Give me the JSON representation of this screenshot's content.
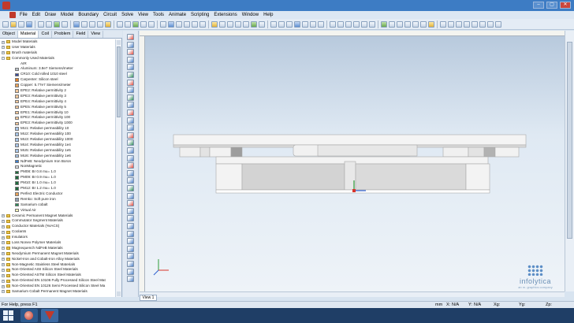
{
  "menu": [
    "File",
    "Edit",
    "Draw",
    "Model",
    "Boundary",
    "Circuit",
    "Solve",
    "View",
    "Tools",
    "Animate",
    "Scripting",
    "Extensions",
    "Window",
    "Help"
  ],
  "panel_tabs": [
    "Object",
    "Material",
    "Coil",
    "Problem",
    "Field",
    "View"
  ],
  "tree": [
    {
      "label": "Model Materials",
      "level": 0,
      "kind": "folder"
    },
    {
      "label": "User Materials",
      "level": 0,
      "kind": "folder"
    },
    {
      "label": "Brush materials",
      "level": 0,
      "kind": "folder"
    },
    {
      "label": "Commonly Used Materials",
      "level": 0,
      "kind": "folder",
      "expanded": true
    },
    {
      "label": "AIR",
      "level": 1,
      "kind": "none"
    },
    {
      "label": "Aluminum: 3.8e7 Siemens/meter",
      "level": 1,
      "color": "#b9c0c9"
    },
    {
      "label": "CR10: Cold rolled 1010 steel",
      "level": 1,
      "color": "#3b4a9a"
    },
    {
      "label": "Carpenter: Silicon steel",
      "level": 1,
      "color": "#e67e22"
    },
    {
      "label": "Copper: 5.77e7 Siemens/meter",
      "level": 1,
      "color": "#e8a25a"
    },
    {
      "label": "EPE2: Relative permittivity 2",
      "level": 1,
      "color": "#f2c89c"
    },
    {
      "label": "EPE3: Relative permittivity 3",
      "level": 1,
      "color": "#f2c89c"
    },
    {
      "label": "EPE4: Relative permittivity 4",
      "level": 1,
      "color": "#f2c89c"
    },
    {
      "label": "EPE5: Relative permittivity 5",
      "level": 1,
      "color": "#f2c89c"
    },
    {
      "label": "EPE1: Relative permittivity 10",
      "level": 1,
      "color": "#f2c89c"
    },
    {
      "label": "EPE2: Relative permittivity 100",
      "level": 1,
      "color": "#f2c89c"
    },
    {
      "label": "EPE3: Relative permittivity 1000",
      "level": 1,
      "color": "#f2c89c"
    },
    {
      "label": "MU1: Relative permeability 10",
      "level": 1,
      "color": "#a9c6e8"
    },
    {
      "label": "MU2: Relative permeability 100",
      "level": 1,
      "color": "#a9c6e8"
    },
    {
      "label": "MU3: Relative permeability 1000",
      "level": 1,
      "color": "#a9c6e8"
    },
    {
      "label": "MU4: Relative permeability 1e4",
      "level": 1,
      "color": "#a9c6e8"
    },
    {
      "label": "MU5: Relative permeability 1e5",
      "level": 1,
      "color": "#a9c6e8"
    },
    {
      "label": "MU6: Relative permeability 1e6",
      "level": 1,
      "color": "#a9c6e8"
    },
    {
      "label": "NdFeB: Neodymium Iron Boron",
      "level": 1,
      "color": "#3a7fd1"
    },
    {
      "label": "NonMagnetic",
      "level": 1,
      "color": "#d9dde2"
    },
    {
      "label": "PM08: Br 0.8 mu= 1.0",
      "level": 1,
      "color": "#1e6b3e"
    },
    {
      "label": "PM09: Br 0.9 mu= 1.0",
      "level": 1,
      "color": "#1e6b3e"
    },
    {
      "label": "PM10: Br 1.0 mu= 1.0",
      "level": 1,
      "color": "#1e6b3e"
    },
    {
      "label": "PM12: Br 1.2 mu= 1.0",
      "level": 1,
      "color": "#1e6b3e"
    },
    {
      "label": "Perfect Electric Conductor",
      "level": 1,
      "color": "#e8a25a"
    },
    {
      "label": "Remko: Soft pure iron",
      "level": 1,
      "color": "#8fa0b3"
    },
    {
      "label": "Samarium cobalt",
      "level": 1,
      "color": "#2d8a5a"
    },
    {
      "label": "Virtual Air",
      "level": 1,
      "color": "#f6f2b8"
    },
    {
      "label": "Ceramic Permanent Magnet Materials",
      "level": 0,
      "kind": "folder"
    },
    {
      "label": "Commutator Segment Materials",
      "level": 0,
      "kind": "folder"
    },
    {
      "label": "Conductor Materials (%IACS)",
      "level": 0,
      "kind": "folder"
    },
    {
      "label": "Coolants",
      "level": 0,
      "kind": "folder"
    },
    {
      "label": "Insulators",
      "level": 0,
      "kind": "folder"
    },
    {
      "label": "Loss Nonex Polymer Materials",
      "level": 0,
      "kind": "folder"
    },
    {
      "label": "Magnequench NdFeB Materials",
      "level": 0,
      "kind": "folder"
    },
    {
      "label": "Neodymium Permanent Magnet Materials",
      "level": 0,
      "kind": "folder"
    },
    {
      "label": "Nickel-Iron and Cobalt-Iron Alloy Materials",
      "level": 0,
      "kind": "folder"
    },
    {
      "label": "Non-Magnetic Stainless Steel Materials",
      "level": 0,
      "kind": "folder"
    },
    {
      "label": "Non-Oriented AISI Silicon Steel Materials",
      "level": 0,
      "kind": "folder"
    },
    {
      "label": "Non-Oriented ASTM Silicon Steel Materials",
      "level": 0,
      "kind": "folder"
    },
    {
      "label": "Non-Oriented EN 10106 Fully Processed Silicon Steel Mat",
      "level": 0,
      "kind": "folder"
    },
    {
      "label": "Non-Oriented EN 10126 Semi Processed Silicon Steel Ma",
      "level": 0,
      "kind": "folder"
    },
    {
      "label": "Samarium Cobalt Permanent Magnet Materials",
      "level": 0,
      "kind": "folder"
    }
  ],
  "view_tab": "View 1",
  "status": {
    "help": "For Help, press F1",
    "units": "mm",
    "x": "X:",
    "y": "Y:",
    "xg": "Xg:",
    "yg": "Yg:",
    "zp": "Zp:",
    "na": "N/A"
  },
  "watermark": {
    "brand": "infolytica",
    "sub": "an m. graphics company"
  },
  "colors": {
    "accent": "#3d7cc4",
    "taskbar": "#1f3e66",
    "model_fill": "#f3f3f3",
    "model_shadow": "#c7c7c7"
  }
}
